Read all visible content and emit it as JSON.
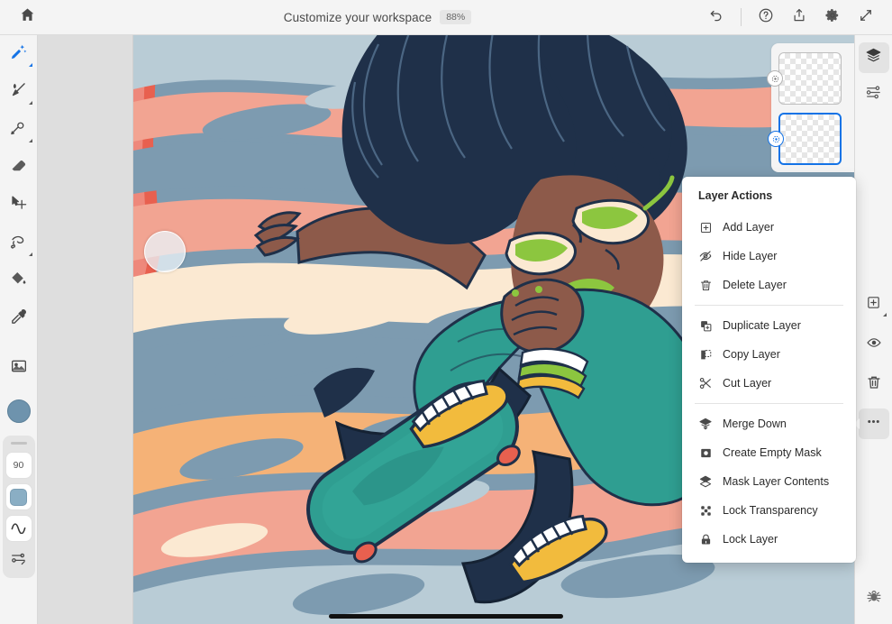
{
  "topbar": {
    "home_icon": "home-icon",
    "title": "Customize your workspace",
    "zoom": "88%",
    "actions": [
      {
        "name": "undo-button",
        "icon": "undo-icon"
      },
      {
        "name": "help-button",
        "icon": "help-circle-icon"
      },
      {
        "name": "share-button",
        "icon": "share-export-icon"
      },
      {
        "name": "settings-button",
        "icon": "gear-icon"
      },
      {
        "name": "fullscreen-button",
        "icon": "expand-arrows-icon"
      }
    ]
  },
  "left_toolbar": {
    "tools": [
      {
        "name": "tool-select-brush",
        "icon": "magic-brush-icon",
        "active": true
      },
      {
        "name": "tool-paintbrush",
        "icon": "paintbrush-icon",
        "active": false
      },
      {
        "name": "tool-smudge",
        "icon": "smudge-icon",
        "active": false
      },
      {
        "name": "tool-eraser",
        "icon": "eraser-icon",
        "active": false
      },
      {
        "name": "tool-move",
        "icon": "move-select-icon",
        "active": false
      },
      {
        "name": "tool-lasso",
        "icon": "lasso-icon",
        "active": false
      },
      {
        "name": "tool-paint-bucket",
        "icon": "paint-bucket-icon",
        "active": false
      },
      {
        "name": "tool-eyedropper",
        "icon": "eyedropper-icon",
        "active": false
      },
      {
        "name": "tool-place-image",
        "icon": "image-icon",
        "active": false
      }
    ],
    "foreground_color": "#6e93ad",
    "brush_size": "90",
    "swatch_color": "#8aaec4",
    "smoothing_icon": "wave-smoothing-icon",
    "brush_settings_icon": "sliders-settings-icon"
  },
  "right_rail": {
    "top": [
      {
        "name": "panel-layers",
        "icon": "layers-icon",
        "selected": true
      },
      {
        "name": "panel-adjustments",
        "icon": "sliders-adjust-icon",
        "selected": false
      }
    ],
    "layer_actions": [
      {
        "name": "add-layer-button",
        "icon": "add-layer-icon"
      },
      {
        "name": "layer-visibility-button",
        "icon": "eye-icon"
      },
      {
        "name": "delete-layer-button",
        "icon": "trash-icon"
      },
      {
        "name": "more-options-button",
        "icon": "ellipsis-icon"
      }
    ],
    "bottom": {
      "name": "debug-button",
      "icon": "bug-icon"
    }
  },
  "layers_panel": {
    "layers": [
      {
        "name": "layer-thumbnail-1",
        "selected": false,
        "visibility_icon": "eye-toggle-icon"
      },
      {
        "name": "layer-thumbnail-2",
        "selected": true,
        "visibility_icon": "eye-toggle-icon"
      }
    ]
  },
  "context_menu": {
    "title": "Layer Actions",
    "groups": [
      [
        {
          "label": "Add Layer",
          "icon": "add-layer-icon"
        },
        {
          "label": "Hide Layer",
          "icon": "eye-slash-icon"
        },
        {
          "label": "Delete Layer",
          "icon": "trash-icon"
        }
      ],
      [
        {
          "label": "Duplicate Layer",
          "icon": "duplicate-layer-icon"
        },
        {
          "label": "Copy Layer",
          "icon": "copy-layer-icon"
        },
        {
          "label": "Cut Layer",
          "icon": "scissors-icon"
        }
      ],
      [
        {
          "label": "Merge Down",
          "icon": "merge-down-icon"
        },
        {
          "label": "Create Empty Mask",
          "icon": "empty-mask-icon"
        },
        {
          "label": "Mask Layer Contents",
          "icon": "mask-contents-icon"
        },
        {
          "label": "Lock Transparency",
          "icon": "lock-transparency-icon"
        },
        {
          "label": "Lock Layer",
          "icon": "lock-icon"
        }
      ]
    ]
  },
  "canvas": {
    "artwork_title": "skateboarder-illustration",
    "palette": {
      "steel_blue": "#7d9bb0",
      "light_blue": "#b9ccd6",
      "salmon": "#f2a492",
      "cream": "#fbe9d2",
      "orange": "#f5b277",
      "coral": "#e8604f",
      "navy": "#1f3049",
      "teal": "#2f9e91",
      "skin": "#8d5a4a",
      "green": "#8cc63f",
      "yellow": "#f2bb3d"
    },
    "brush_cursor": {
      "name": "brush-size-cursor"
    },
    "home_indicator": {
      "name": "home-indicator-bar"
    }
  }
}
